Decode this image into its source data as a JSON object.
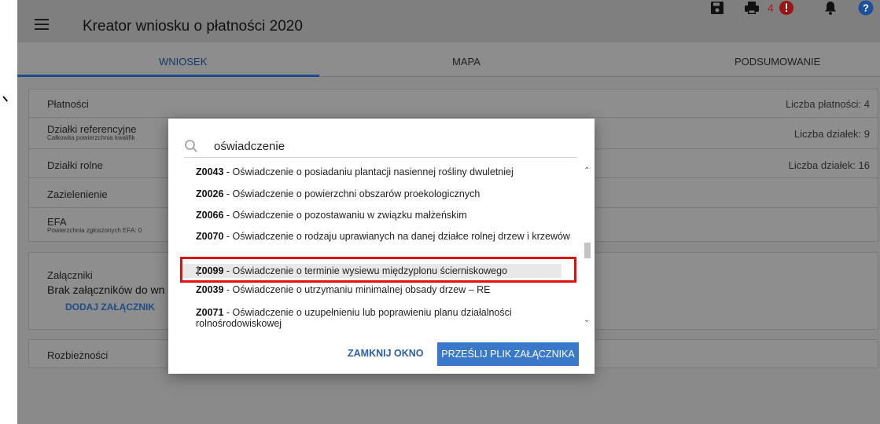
{
  "header": {
    "title": "Kreator wniosku o płatności 2020",
    "error_count": "4",
    "icons": [
      "menu-icon",
      "save-icon",
      "print-icon",
      "error-icon",
      "bell-icon",
      "help-icon"
    ]
  },
  "tabs": [
    {
      "label": "WNIOSEK",
      "active": true
    },
    {
      "label": "MAPA",
      "active": false
    },
    {
      "label": "PODSUMOWANIE",
      "active": false
    }
  ],
  "sections": {
    "platnosci": {
      "label": "Płatności",
      "right": "Liczba płatności: 4"
    },
    "dzialki_ref": {
      "label": "Działki referencyjne",
      "sub": "Całkowita powierzchnia kwalifik",
      "right": "Liczba działek: 9"
    },
    "dzialki_rolne": {
      "label": "Działki rolne",
      "right": "Liczba działek: 16"
    },
    "zazielenienie": {
      "label": "Zazielenienie"
    },
    "efa": {
      "label": "EFA",
      "sub": "Powierzchnia zgłoszonych EFA: 0"
    }
  },
  "attachments": {
    "label": "Załączniki",
    "none_text": "Brak załączników do wn",
    "add_button": "DODAJ ZAŁĄCZNIK"
  },
  "discrepancies": {
    "label": "Rozbieżności"
  },
  "modal": {
    "search_value": "oświadczenie",
    "items": [
      {
        "code": "Z0043",
        "text": " - Oświadczenie o posiadaniu plantacji nasiennej rośliny dwuletniej"
      },
      {
        "code": "Z0026",
        "text": " - Oświadczenie o powierzchni obszarów proekologicznych"
      },
      {
        "code": "Z0066",
        "text": " - Oświadczenie o pozostawaniu w związku małżeńskim"
      },
      {
        "code": "Z0070",
        "text": " - Oświadczenie o rodzaju uprawianych na danej działce rolnej drzew i krzewów"
      },
      {
        "code": "Z0099",
        "text": " - Oświadczenie o terminie wysiewu międzyplonu ścierniskowego",
        "selected": true
      },
      {
        "code": "Z0039",
        "text": " - Oświadczenie o utrzymaniu minimalnej obsady drzew – RE"
      },
      {
        "code": "Z0071",
        "text": " - Oświadczenie o uzupełnieniu lub poprawieniu planu działalności rolnośrodowiskowej"
      }
    ],
    "close_button": "ZAMKNIJ OKNO",
    "send_button": "PRZEŚLIJ PLIK ZAŁĄCZNIKA"
  }
}
